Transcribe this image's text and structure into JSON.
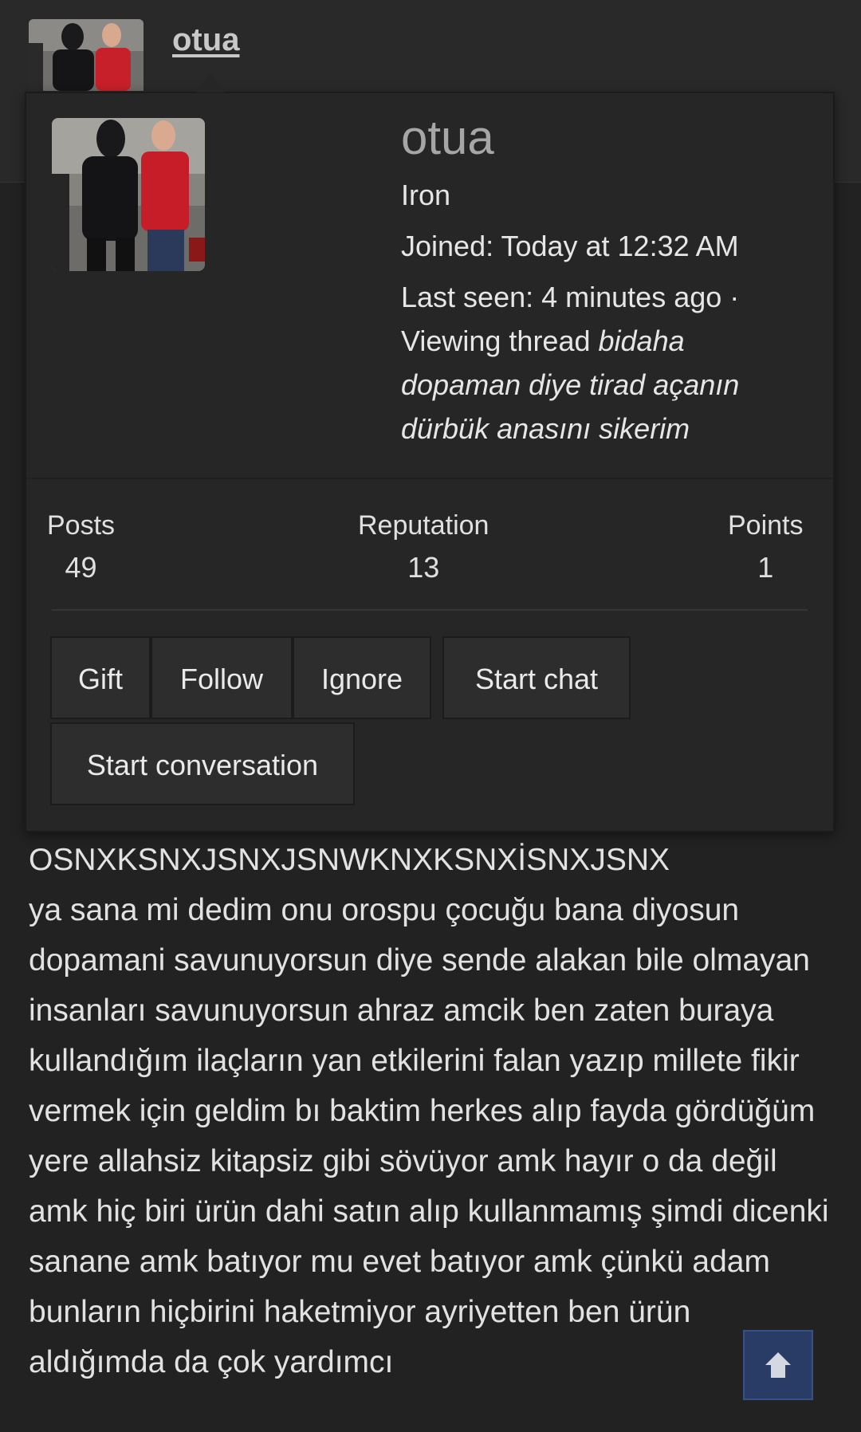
{
  "thread": {
    "username": "otua"
  },
  "card": {
    "username": "otua",
    "rank": "Iron",
    "joined": "Joined: Today at 12:32 AM",
    "last_seen_prefix": "Last seen: 4 minutes ago · Viewing thread ",
    "last_seen_thread": "bidaha dopaman diye tirad açanın dürbük anasını sikerim",
    "stats": [
      {
        "label": "Posts",
        "value": "49"
      },
      {
        "label": "Reputation",
        "value": "13"
      },
      {
        "label": "Points",
        "value": "1"
      }
    ],
    "buttons": {
      "gift": "Gift",
      "follow": "Follow",
      "ignore": "Ignore",
      "start_chat": "Start chat",
      "start_conversation": "Start conversation"
    }
  },
  "post": {
    "line1": "OSNXKSNXJSNXJSNWKNXKSNXİSNXJSNX",
    "body": "ya sana mi dedim onu orospu çocuğu bana diyosun dopamani savunuyorsun diye sende alakan bile olmayan insanları savunuyorsun ahraz amcik ben zaten buraya kullandığım ilaçların yan etkilerini falan yazıp millete fikir vermek için geldim bı baktim herkes alıp fayda gördüğüm yere allahsiz kitapsiz gibi sövüyor amk hayır o da değil amk hiç biri ürün dahi satın alıp kullanmamış şimdi dicenki sanane amk batıyor mu evet batıyor amk çünkü adam bunların hiçbirini haketmiyor ayriyetten ben ürün aldığımda da çok yardımcı"
  },
  "icons": {
    "scroll_top": "arrow-up-icon",
    "avatar": "user-avatar-photo"
  }
}
